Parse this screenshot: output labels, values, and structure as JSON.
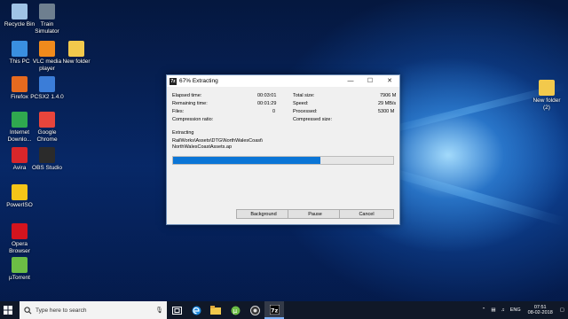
{
  "desktop": {
    "icons": [
      {
        "label": "Recycle Bin",
        "icon": "recycle-bin-icon",
        "color": "#9fc3e6"
      },
      {
        "label": "Train Simulator",
        "icon": "train-simulator-icon",
        "color": "#6e7f8f"
      },
      {
        "label": "This PC",
        "icon": "this-pc-icon",
        "color": "#3a8fe0"
      },
      {
        "label": "VLC media player",
        "icon": "vlc-icon",
        "color": "#f08a1c"
      },
      {
        "label": "New folder",
        "icon": "folder-icon",
        "color": "#f2c94c"
      },
      {
        "label": "Firefox",
        "icon": "firefox-icon",
        "color": "#e66a1f"
      },
      {
        "label": "PCSX2 1.4.0",
        "icon": "pcsx2-icon",
        "color": "#3b7dd8"
      },
      {
        "label": "Internet Downlo...",
        "icon": "idm-icon",
        "color": "#2fa84f"
      },
      {
        "label": "Google Chrome",
        "icon": "chrome-icon",
        "color": "#e8453c"
      },
      {
        "label": "Avira",
        "icon": "avira-icon",
        "color": "#d9262a"
      },
      {
        "label": "OBS Studio",
        "icon": "obs-icon",
        "color": "#2b2b2b"
      },
      {
        "label": "PowerISO",
        "icon": "poweriso-icon",
        "color": "#f5c518"
      },
      {
        "label": "Opera Browser",
        "icon": "opera-icon",
        "color": "#d4141e"
      },
      {
        "label": "µTorrent",
        "icon": "utorrent-icon",
        "color": "#6cbd45"
      },
      {
        "label": "New folder (2)",
        "icon": "folder-icon",
        "color": "#f2c94c"
      }
    ]
  },
  "window": {
    "title": "67% Extracting",
    "elapsed_label": "Elapsed time:",
    "elapsed_value": "00:03:01",
    "remaining_label": "Remaining time:",
    "remaining_value": "00:01:29",
    "files_label": "Files:",
    "files_value": "0",
    "ratio_label": "Compression ratio:",
    "total_label": "Total size:",
    "total_value": "7906 M",
    "speed_label": "Speed:",
    "speed_value": "29 MB/s",
    "processed_label": "Processed:",
    "processed_value": "5300 M",
    "compressed_label": "Compressed size:",
    "extracting_label": "Extracting",
    "path_line1": "RailWorks\\Assets\\DTG\\NorthWalesCoast\\",
    "path_line2": "NorthWalesCoastAssets.ap",
    "progress": 0.67,
    "btn_background": "Background",
    "btn_pause": "Pause",
    "btn_cancel": "Cancel"
  },
  "taskbar": {
    "search_placeholder": "Type here to search",
    "language": "ENG",
    "time": "07:51",
    "date": "08-02-2018"
  }
}
